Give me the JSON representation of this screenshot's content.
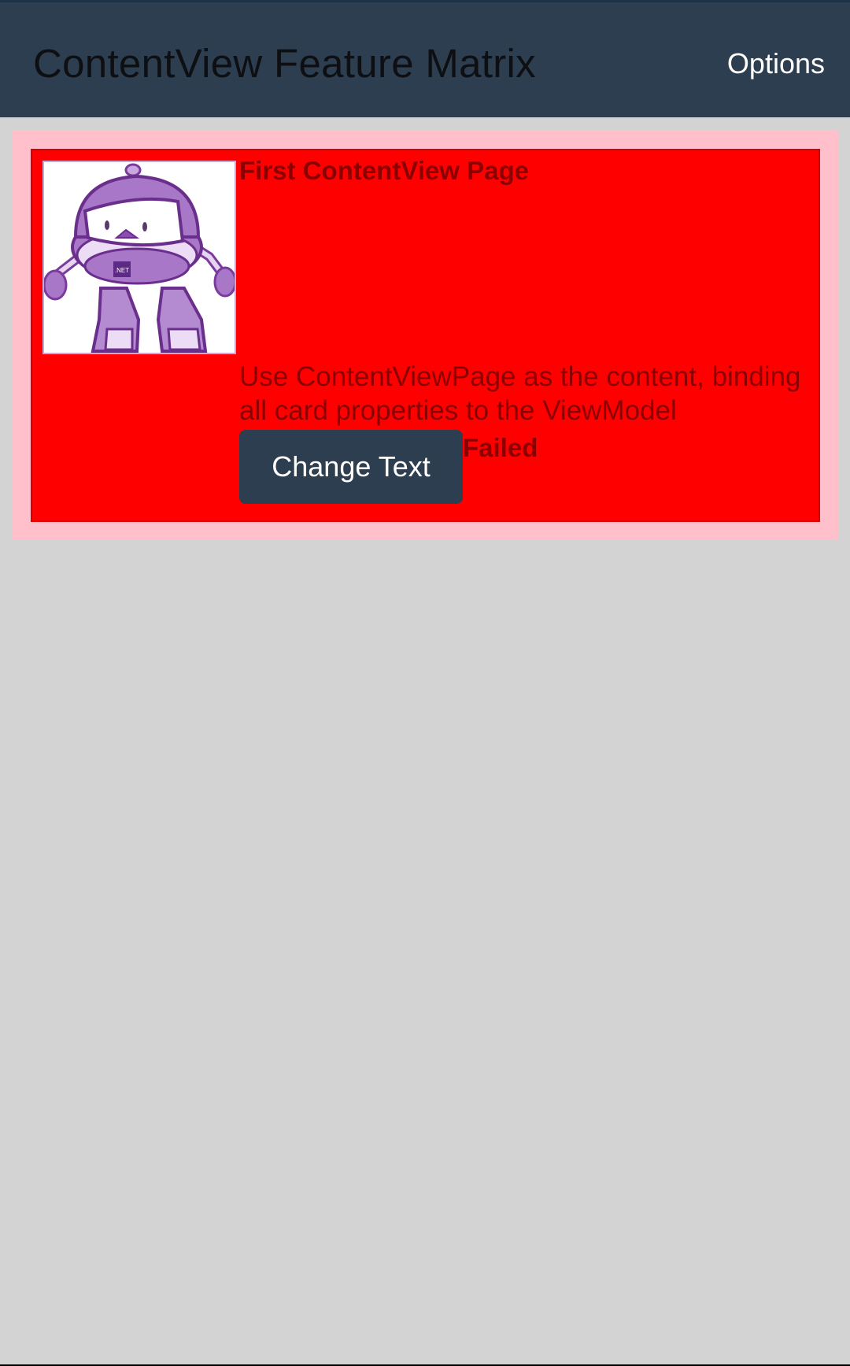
{
  "header": {
    "title": "ContentView Feature Matrix",
    "options_label": "Options"
  },
  "card": {
    "title": "First ContentView Page",
    "description_line1": "Use ContentViewPage as the content, binding",
    "description_line2": "all card properties to the ViewModel",
    "button_label": "Change Text",
    "status": "Failed",
    "image_label": ".NET",
    "icon": "dotnet-bot-image"
  },
  "colors": {
    "toolbar_bg": "#2d3e50",
    "page_bg": "#d3d3d3",
    "frame_bg": "#ffc0cb",
    "card_bg": "#ff0000",
    "card_text": "#8a0000",
    "button_bg": "#2d3e50"
  }
}
